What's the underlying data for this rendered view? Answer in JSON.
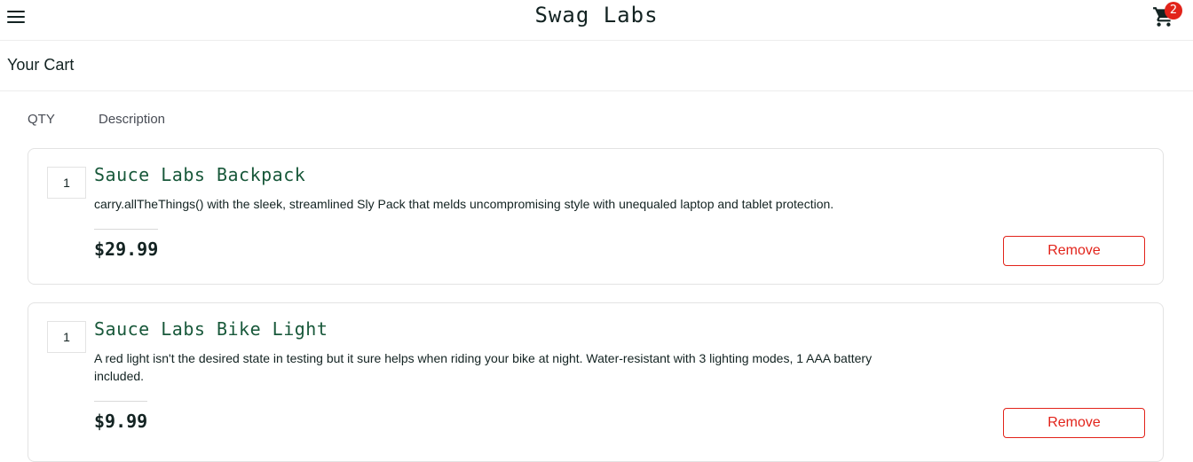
{
  "header": {
    "app_title": "Swag Labs",
    "menu_icon": "menu-icon",
    "cart_icon": "shopping-cart-icon",
    "cart_count": "2"
  },
  "page": {
    "title": "Your Cart"
  },
  "columns": {
    "qty": "QTY",
    "description": "Description"
  },
  "cart": {
    "items": [
      {
        "quantity": "1",
        "name": "Sauce Labs Backpack",
        "description": "carry.allTheThings() with the sleek, streamlined Sly Pack that melds uncompromising style with unequaled laptop and tablet protection.",
        "price": "$29.99",
        "remove_label": "Remove"
      },
      {
        "quantity": "1",
        "name": "Sauce Labs Bike Light",
        "description": "A red light isn't the desired state in testing but it sure helps when riding your bike at night. Water-resistant with 3 lighting modes, 1 AAA battery included.",
        "price": "$9.99",
        "remove_label": "Remove"
      }
    ]
  },
  "colors": {
    "accent_red": "#e2231a",
    "product_name_green": "#18583a",
    "text_dark": "#132322"
  }
}
